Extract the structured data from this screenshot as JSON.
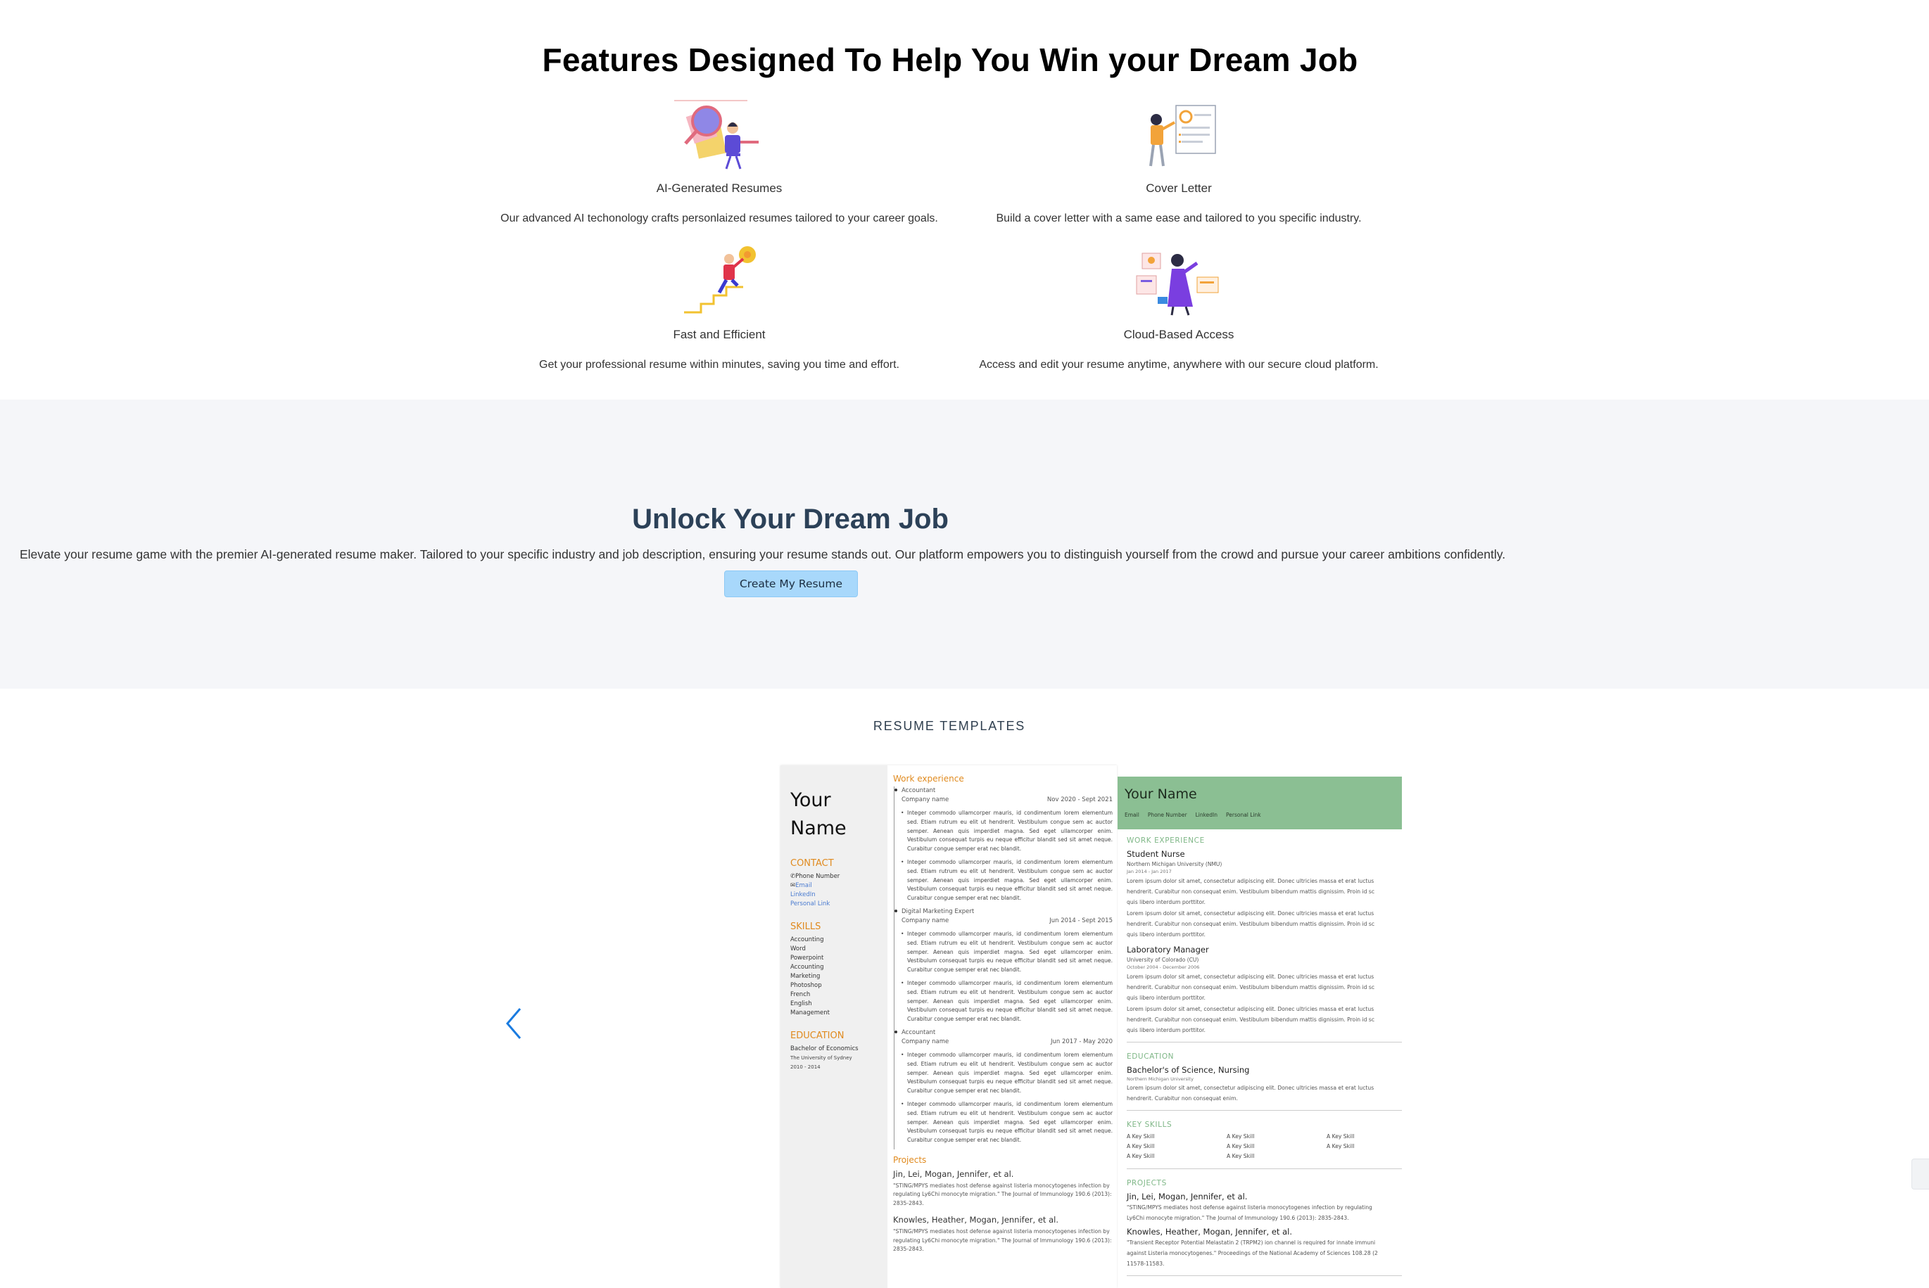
{
  "features": {
    "title": "Features Designed To Help You Win your Dream Job",
    "items": [
      {
        "icon": "ai-resume-illustration",
        "name": "AI-Generated Resumes",
        "description": "Our advanced AI techonology crafts personlaized resumes tailored to your career goals."
      },
      {
        "icon": "cover-letter-illustration",
        "name": "Cover Letter",
        "description": "Build a cover letter with a same ease and tailored to you specific industry."
      },
      {
        "icon": "fast-efficient-illustration",
        "name": "Fast and Efficient",
        "description": "Get your professional resume within minutes, saving you time and effort."
      },
      {
        "icon": "cloud-access-illustration",
        "name": "Cloud-Based Access",
        "description": "Access and edit your resume anytime, anywhere with our secure cloud platform."
      }
    ]
  },
  "unlock": {
    "title": "Unlock Your Dream Job",
    "text": "Elevate your resume game with the premier AI-generated resume maker. Tailored to your specific industry and job description, ensuring your resume stands out. Our platform empowers you to distinguish yourself from the crowd and pursue your career ambitions confidently.",
    "cta_label": "Create My Resume"
  },
  "templates": {
    "label": "RESUME TEMPLATES",
    "prev_icon": "chevron-left-icon",
    "next_icon": "chevron-right-icon",
    "template1": {
      "name_line1": "Your",
      "name_line2": "Name",
      "contact_heading": "CONTACT",
      "phone": "Phone Number",
      "email": "Email",
      "linkedin": "LinkedIn",
      "personal_link": "Personal Link",
      "skills_heading": "SKILLS",
      "skills": [
        "Accounting",
        "Word",
        "Powerpoint",
        "Accounting",
        "Marketing",
        "Photoshop",
        "French",
        "English",
        "Management"
      ],
      "education_heading": "EDUCATION",
      "degree": "Bachelor of Economics",
      "school": "The University of Sydney",
      "years": "2010 - 2014",
      "work_heading": "Work experience",
      "jobs": [
        {
          "role": "Accountant",
          "company": "Company name",
          "dates": "Nov 2020 - Sept 2021"
        },
        {
          "role": "Digital Marketing Expert",
          "company": "Company name",
          "dates": "Jun 2014 - Sept 2015"
        },
        {
          "role": "Accountant",
          "company": "Company name",
          "dates": "Jun 2017 - May 2020"
        }
      ],
      "bullet_text": "Integer commodo ullamcorper mauris, id condimentum lorem elementum sed. Etiam rutrum eu elit ut hendrerit. Vestibulum congue sem ac auctor semper. Aenean quis imperdiet magna. Sed eget ullamcorper enim. Vestibulum consequat turpis eu neque efficitur blandit sed sit amet neque. Curabitur congue semper erat nec blandit.",
      "projects_heading": "Projects",
      "publications": [
        {
          "authors": "Jin, Lei, Mogan, Jennifer, et al.",
          "text": "\"STING/MPYS mediates host defense against listeria monocytogenes infection by regulating Ly6Chi monocyte migration.\" The Journal of Immunology 190.6 (2013): 2835-2843."
        },
        {
          "authors": "Knowles, Heather, Mogan, Jennifer, et al.",
          "text": "\"STING/MPYS mediates host defense against listeria monocytogenes infection by regulating Ly6Chi monocyte migration.\" The Journal of Immunology 190.6 (2013): 2835-2843."
        }
      ]
    },
    "template2": {
      "name": "Your Name",
      "links": [
        "Email",
        "Phone Number",
        "LinkedIn",
        "Personal Link"
      ],
      "work_heading": "WORK EXPERIENCE",
      "jobs": [
        {
          "title": "Student Nurse",
          "org": "Northern Michigan University (NMU)",
          "dates": "Jan 2014 - Jan 2017"
        },
        {
          "title": "Laboratory Manager",
          "org": "University of Colorado (CU)",
          "dates": "October 2004 - December 2006"
        }
      ],
      "bullet_line1": "Lorem ipsum dolor sit amet, consectetur adipiscing elit. Donec ultricies massa et erat luctus",
      "bullet_line2": "hendrerit. Curabitur non consequat enim. Vestibulum bibendum mattis dignissim. Proin id sc",
      "bullet_line3": "quis libero interdum porttitor.",
      "education_heading": "EDUCATION",
      "degree": "Bachelor's of Science, Nursing",
      "school": "Northern Michigan University",
      "edu_line1": "Lorem ipsum dolor sit amet, consectetur adipiscing elit. Donec ultricies massa et erat luctus",
      "edu_line2": "hendrerit. Curabitur non consequat enim.",
      "skills_heading": "KEY SKILLS",
      "skill_label": "A Key Skill",
      "projects_heading": "PROJECTS",
      "publications": [
        {
          "authors": "Jin, Lei, Mogan, Jennifer, et al.",
          "line1": "\"STING/MPYS mediates host defense against listeria monocytogenes infection by regulating",
          "line2": "Ly6Chi monocyte migration.\" The Journal of Immunology 190.6 (2013): 2835-2843."
        },
        {
          "authors": "Knowles, Heather, Mogan, Jennifer, et al.",
          "line1": "\"Transient Receptor Potential Melastatin 2 (TRPM2) ion channel is required for innate immuni",
          "line2": "against Listeria monocytogenes.\" Proceedings of the National Academy of Sciences 108.28 (2",
          "line3": "11578-11583."
        }
      ]
    }
  },
  "colors": {
    "heading_dark": "#2c4158",
    "cta_bg": "#a8d8fb",
    "section_bg": "#f5f6f9",
    "template1_accent": "#e08a1e",
    "template2_header": "#8bbf93",
    "arrow": "#1a7be0"
  }
}
